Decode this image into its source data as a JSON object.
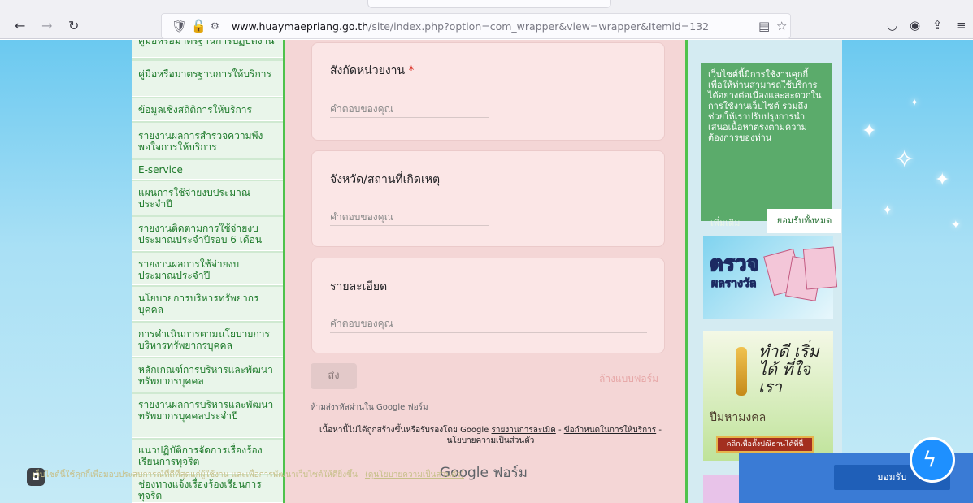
{
  "browser": {
    "url_domain": "www.huaymaepriang.go.th",
    "url_path": "/site/index.php?option=com_wrapper&view=wrapper&Itemid=132"
  },
  "leftnav": {
    "items": [
      "คู่มือหรือมาตรฐานการปฏิบัติงาน",
      "คู่มือหรือมาตรฐานการให้บริการ",
      "ข้อมูลเชิงสถิติการให้บริการ",
      "รายงานผลการสำรวจความพึงพอใจการให้บริการ",
      "E-service",
      "แผนการใช้จ่ายงบประมาณประจำปี",
      "รายงานติดตามการใช้จ่ายงบประมาณประจำปีรอบ 6 เดือน",
      "รายงานผลการใช้จ่ายงบประมาณประจำปี",
      "นโยบายการบริหารทรัพยากรบุคคล",
      "การดำเนินการตามนโยบายการบริหารทรัพยากรบุคคล",
      "หลักเกณฑ์การบริหารและพัฒนาทรัพยากรบุคคล",
      "รายงานผลการบริหารและพัฒนาทรัพยากรบุคคลประจำปี",
      "แนวปฏิบัติการจัดการเรื่องร้องเรียนการทุจริต",
      "ช่องทางแจ้งเรื่องร้องเรียนการทุจริต"
    ]
  },
  "form": {
    "q1_title": "สังกัดหน่วยงาน",
    "q1_required": "*",
    "q2_title": "จังหวัด/สถานที่เกิดเหตุ",
    "q3_title": "รายละเอียด",
    "answer_placeholder": "คำตอบของคุณ",
    "send_label": "ส่ง",
    "clear_label": "ล้างแบบฟอร์ม",
    "password_note": "ห้ามส่งรหัสผ่านใน Google ฟอร์ม",
    "disclaimer_prefix": "เนื้อหานี้ไม่ได้ถูกสร้างขึ้นหรือรับรองโดย Google",
    "link_report": "รายงานการละเมิด",
    "link_terms": "ข้อกำหนดในการให้บริการ",
    "link_privacy": "นโยบายความเป็นส่วนตัว",
    "brand": "Google ฟอร์ม"
  },
  "cookie": {
    "text": "เว็บไซต์นี้มีการใช้งานคุกกี้ เพื่อให้ท่านสามารถใช้บริการได้อย่างต่อเนื่องและสะดวกในการใช้งานเว็บไซต์ รวมถึงช่วยให้เราปรับปรุงการนำเสนอเนื้อหาตรงตามความต้องการของท่าน",
    "more": "เพิ่มเติม",
    "accept_all": "ยอมรับทั้งหมด",
    "bottom_text": "เว็บไซต์นี้ใช้คุกกี้เพื่อมอบประสบการณ์ที่ดีที่สุดแก่ผู้ใช้งาน และเพื่อการพัฒนาเว็บไซต์ให้ดียิ่งขึ้น",
    "bottom_link": "(ดูนโยบายความเป็นส่วนตัว)",
    "accept": "ยอมรับ"
  },
  "banners": {
    "lottery_title": "ตรวจ",
    "lottery_sub": "ผลรางวัล",
    "merit_text": "ทำดี เริ่มได้ ที่ใจเรา",
    "merit_small": "ปีมหามงคล",
    "merit_button": "คลิกเพื่อตั้งปณิธานได้ที่นี่"
  }
}
